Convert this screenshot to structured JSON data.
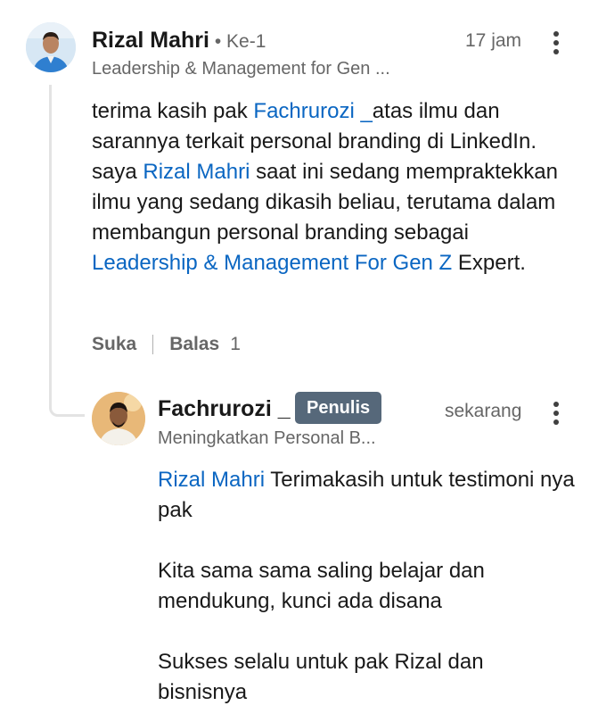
{
  "comment": {
    "author": "Rizal Mahri",
    "degree": "Ke-1",
    "headline": "Leadership & Management for Gen ...",
    "time": "17 jam",
    "segments": [
      {
        "text": "terima kasih pak ",
        "link": false
      },
      {
        "text": "Fachrurozi _",
        "link": true
      },
      {
        "text": "atas ilmu dan sarannya terkait personal branding di LinkedIn. saya ",
        "link": false
      },
      {
        "text": "Rizal Mahri",
        "link": true
      },
      {
        "text": " saat ini sedang mempraktekkan ilmu yang sedang dikasih beliau, terutama dalam membangun personal branding sebagai ",
        "link": false
      },
      {
        "text": "Leadership & Management For Gen Z",
        "link": true
      },
      {
        "text": " Expert.",
        "link": false
      }
    ],
    "actions": {
      "like": "Suka",
      "reply": "Balas",
      "reply_count": "1"
    }
  },
  "reply": {
    "author": "Fachrurozi _",
    "badge": "Penulis",
    "headline": "Meningkatkan Personal B...",
    "time": "sekarang",
    "mention": "Rizal Mahri",
    "line1_rest": " Terimakasih untuk testimoni nya pak",
    "para2": "Kita sama sama saling belajar dan mendukung, kunci ada disana",
    "para3": "Sukses selalu untuk pak Rizal dan bisnisnya"
  },
  "icons": {
    "more": "more-vertical-icon"
  }
}
